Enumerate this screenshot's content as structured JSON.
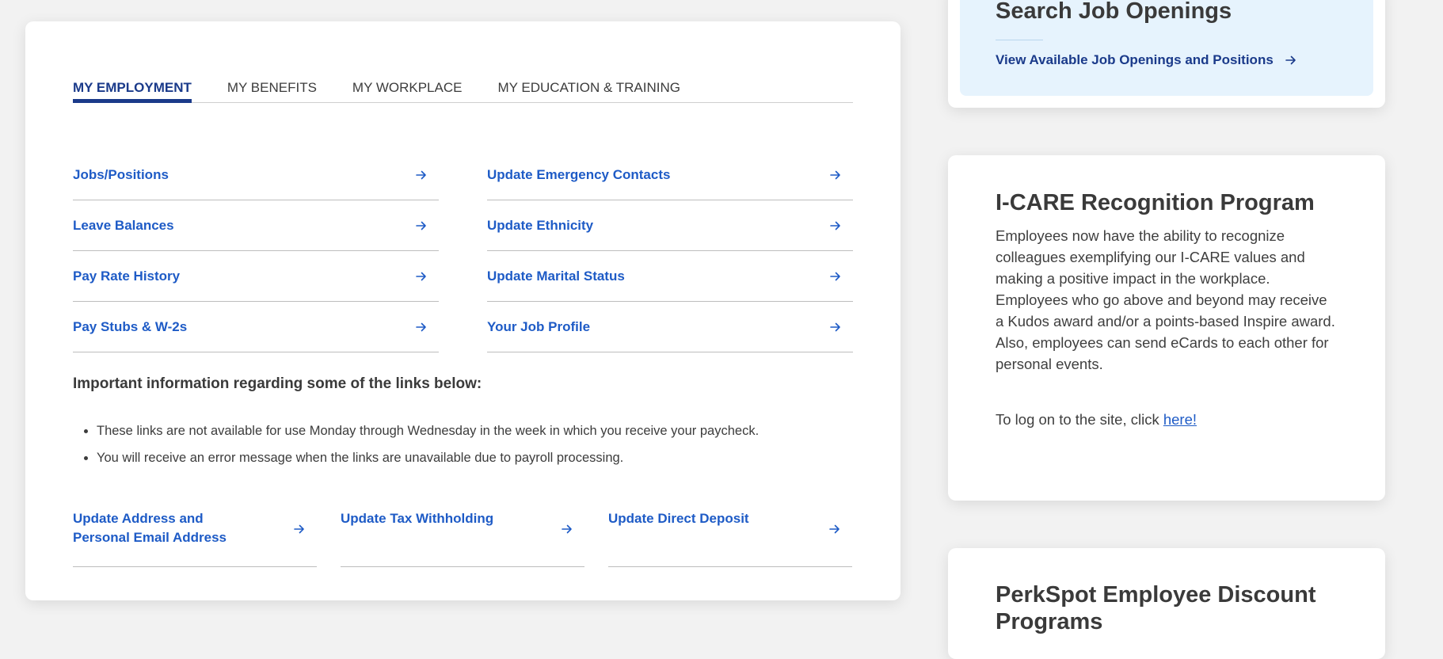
{
  "tabs": [
    {
      "label": "MY EMPLOYMENT",
      "active": true
    },
    {
      "label": "MY BENEFITS",
      "active": false
    },
    {
      "label": "MY WORKPLACE",
      "active": false
    },
    {
      "label": "MY EDUCATION & TRAINING",
      "active": false
    }
  ],
  "employment_links": {
    "left": [
      {
        "label": "Jobs/Positions"
      },
      {
        "label": "Leave Balances"
      },
      {
        "label": "Pay Rate History"
      },
      {
        "label": "Pay Stubs & W-2s"
      }
    ],
    "right": [
      {
        "label": "Update Emergency Contacts"
      },
      {
        "label": "Update Ethnicity"
      },
      {
        "label": "Update Marital Status"
      },
      {
        "label": "Your Job Profile"
      }
    ]
  },
  "info": {
    "heading": "Important information regarding some of the links below:",
    "bullets": [
      "These links are not available for use Monday through Wednesday in the week in which you receive your paycheck.",
      "You will receive an error message when the links are unavailable due to payroll processing."
    ]
  },
  "payroll_links": [
    {
      "label": "Update Address and Personal Email Address"
    },
    {
      "label": "Update Tax Withholding"
    },
    {
      "label": "Update Direct Deposit"
    }
  ],
  "jobs_card": {
    "title": "Search Job Openings",
    "link_label": "View Available Job Openings and Positions"
  },
  "icare_card": {
    "title": "I-CARE Recognition Program",
    "body": "Employees now have the ability to recognize colleagues exemplifying our I-CARE values and making a positive impact in the workplace. Employees who go above and beyond may receive a Kudos award and/or a points-based Inspire award. Also, employees can send eCards to each other for personal events.",
    "login_prefix": "To log on to the site, click ",
    "login_link": "here!"
  },
  "perkspot_card": {
    "title": "PerkSpot Employee Discount Programs"
  },
  "colors": {
    "link_blue": "#1e5bc6",
    "tab_active": "#1a3a8a",
    "jobs_bg": "#e6f3fd",
    "page_bg": "#f2f2f2"
  },
  "icons": {
    "link_arrow": "arrow-right-icon"
  }
}
